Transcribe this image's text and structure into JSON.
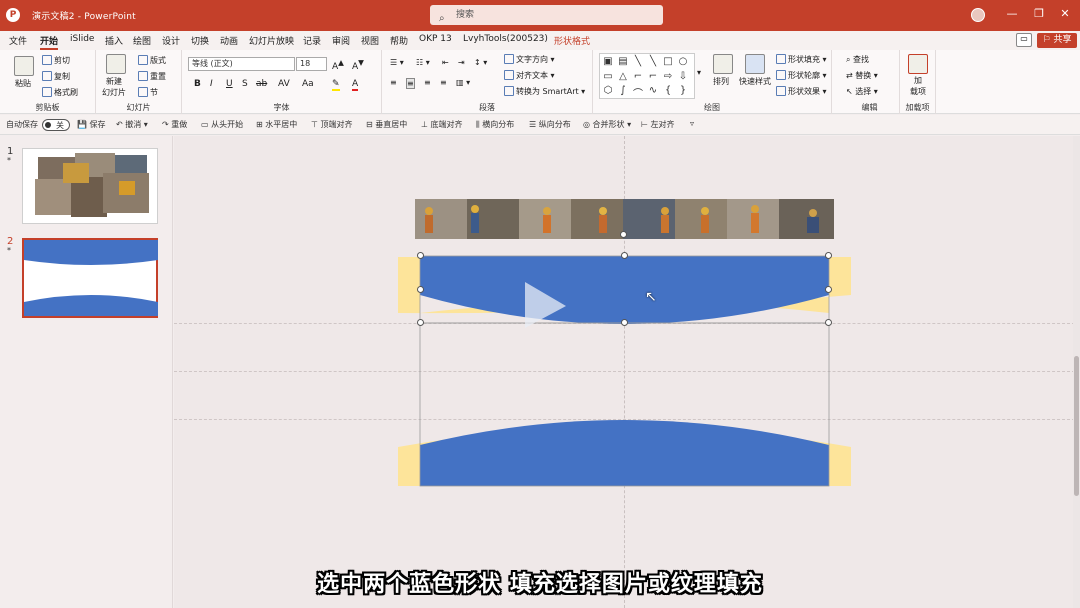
{
  "titlebar": {
    "logo": "P",
    "doc_title": "演示文稿2 - PowerPoint",
    "search_placeholder": "搜索",
    "search_icon": "search-icon",
    "minimize": "—",
    "restore": "❐",
    "close": "✕"
  },
  "menu": {
    "tabs": [
      "文件",
      "开始",
      "iSlide",
      "插入",
      "绘图",
      "设计",
      "切换",
      "动画",
      "幻灯片放映",
      "记录",
      "审阅",
      "视图",
      "帮助",
      "OKP 13",
      "LvyhTools(200523)",
      "形状格式"
    ],
    "active": "开始",
    "comment_icon": "comment-icon",
    "share_label": "⚐ 共享"
  },
  "ribbon": {
    "clipboard": {
      "paste": "粘贴",
      "cut": "剪切",
      "copy": "复制",
      "format_painter": "格式刷",
      "label": "剪贴板"
    },
    "slides": {
      "new_slide": "新建\n幻灯片",
      "layout": "版式",
      "reset": "重置",
      "section": "节",
      "label": "幻灯片"
    },
    "font": {
      "font_name": "等线 (正文)",
      "font_size": "18",
      "bold": "B",
      "italic": "I",
      "underline": "U",
      "strike": "S",
      "shadow": "ab",
      "spacing": "AV",
      "case": "Aa",
      "font_color": "A",
      "label": "字体"
    },
    "paragraph": {
      "text_direction": "文字方向",
      "align_text": "对齐文本",
      "smartart": "转换为 SmartArt",
      "label": "段落"
    },
    "drawing": {
      "arrange": "排列",
      "quick_styles": "快速样式",
      "shape_fill": "形状填充",
      "shape_outline": "形状轮廓",
      "shape_effects": "形状效果",
      "label": "绘图"
    },
    "editing": {
      "find": "查找",
      "replace": "替换",
      "select": "选择",
      "label": "编辑"
    },
    "addins": {
      "addin": "加\n载项",
      "label": "加载项"
    }
  },
  "qat": {
    "autosave": "自动保存",
    "autosave_state": "关",
    "save": "保存",
    "undo": "撤消",
    "redo": "重做",
    "from_start": "从头开始",
    "center_h": "水平居中",
    "align_top": "顶端对齐",
    "center_v": "垂直居中",
    "align_bottom": "底端对齐",
    "dist_h": "横向分布",
    "dist_v": "纵向分布",
    "merge_shapes": "合并形状",
    "align_left": "左对齐"
  },
  "slides": [
    {
      "number": "1",
      "star": "*"
    },
    {
      "number": "2",
      "star": "*"
    }
  ],
  "subtitle": "选中两个蓝色形状 填充选择图片或纹理填充",
  "colors": {
    "accent": "#c4402a",
    "shape_blue": "#4472c4",
    "shape_yellow": "#fde49a"
  }
}
